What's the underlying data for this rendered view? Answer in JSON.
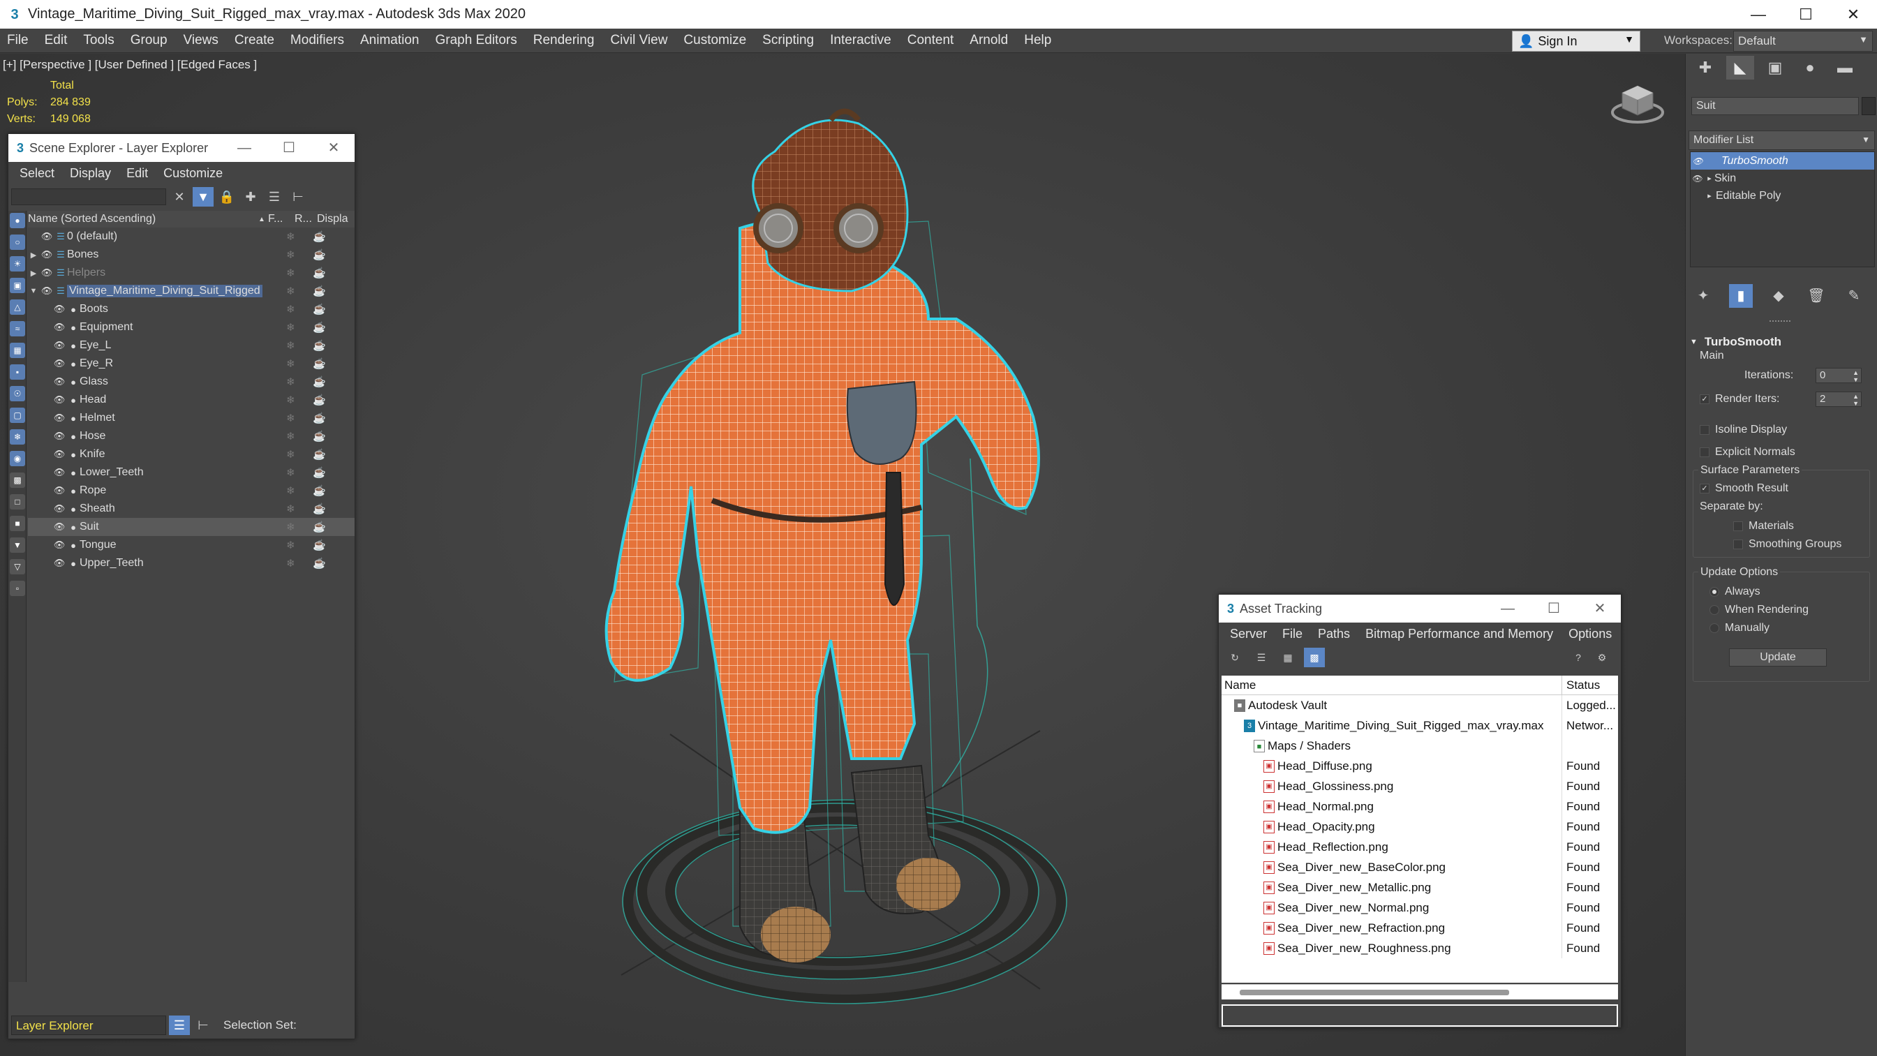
{
  "window": {
    "title": "Vintage_Maritime_Diving_Suit_Rigged_max_vray.max - Autodesk 3ds Max 2020",
    "minimize_icon": "minimize-icon",
    "maximize_icon": "maximize-icon",
    "close_icon": "close-icon"
  },
  "menubar": {
    "items": [
      "File",
      "Edit",
      "Tools",
      "Group",
      "Views",
      "Create",
      "Modifiers",
      "Animation",
      "Graph Editors",
      "Rendering",
      "Civil View",
      "Customize",
      "Scripting",
      "Interactive",
      "Content",
      "Arnold",
      "Help"
    ],
    "signin_label": "Sign In",
    "workspaces_label": "Workspaces:",
    "workspace_value": "Default"
  },
  "viewport": {
    "label": "[+] [Perspective ] [User Defined ] [Edged Faces ]",
    "stats": {
      "total_label": "Total",
      "polys_label": "Polys:",
      "polys_value": "284 839",
      "verts_label": "Verts:",
      "verts_value": "149 068"
    },
    "colors": {
      "suit": "#e8743a",
      "wire": "#ffffff",
      "selection": "#35d2e6",
      "bones": "#2fb6a8"
    }
  },
  "scene_explorer": {
    "title": "Scene Explorer - Layer Explorer",
    "menu": [
      "Select",
      "Display",
      "Edit",
      "Customize"
    ],
    "columns": {
      "name": "Name (Sorted Ascending)",
      "c1": "F...",
      "c2": "R...",
      "c3": "Displa"
    },
    "rows": [
      {
        "name": "0 (default)",
        "level": 0,
        "expand": "",
        "type": "layer"
      },
      {
        "name": "Bones",
        "level": 0,
        "expand": "▶",
        "type": "layer"
      },
      {
        "name": "Helpers",
        "level": 0,
        "expand": "▶",
        "type": "layer",
        "dim": true
      },
      {
        "name": "Vintage_Maritime_Diving_Suit_Rigged",
        "level": 0,
        "expand": "▼",
        "type": "layer",
        "highlight": true
      },
      {
        "name": "Boots",
        "level": 1,
        "type": "object"
      },
      {
        "name": "Equipment",
        "level": 1,
        "type": "object"
      },
      {
        "name": "Eye_L",
        "level": 1,
        "type": "object"
      },
      {
        "name": "Eye_R",
        "level": 1,
        "type": "object"
      },
      {
        "name": "Glass",
        "level": 1,
        "type": "object"
      },
      {
        "name": "Head",
        "level": 1,
        "type": "object"
      },
      {
        "name": "Helmet",
        "level": 1,
        "type": "object"
      },
      {
        "name": "Hose",
        "level": 1,
        "type": "object"
      },
      {
        "name": "Knife",
        "level": 1,
        "type": "object"
      },
      {
        "name": "Lower_Teeth",
        "level": 1,
        "type": "object"
      },
      {
        "name": "Rope",
        "level": 1,
        "type": "object"
      },
      {
        "name": "Sheath",
        "level": 1,
        "type": "object"
      },
      {
        "name": "Suit",
        "level": 1,
        "type": "object",
        "selected": true
      },
      {
        "name": "Tongue",
        "level": 1,
        "type": "object"
      },
      {
        "name": "Upper_Teeth",
        "level": 1,
        "type": "object"
      }
    ],
    "footer": {
      "explorer_name": "Layer Explorer",
      "selection_set_label": "Selection Set:"
    }
  },
  "asset_tracking": {
    "title": "Asset Tracking",
    "menu": [
      "Server",
      "File",
      "Paths",
      "Bitmap Performance and Memory",
      "Options"
    ],
    "columns": {
      "name": "Name",
      "status": "Status"
    },
    "rows": [
      {
        "name": "Autodesk Vault",
        "status": "Logged...",
        "level": 1,
        "icon": "vault"
      },
      {
        "name": "Vintage_Maritime_Diving_Suit_Rigged_max_vray.max",
        "status": "Networ...",
        "level": 2,
        "icon": "max"
      },
      {
        "name": "Maps / Shaders",
        "status": "",
        "level": 3,
        "icon": "folder"
      },
      {
        "name": "Head_Diffuse.png",
        "status": "Found",
        "level": 4,
        "icon": "file"
      },
      {
        "name": "Head_Glossiness.png",
        "status": "Found",
        "level": 4,
        "icon": "file"
      },
      {
        "name": "Head_Normal.png",
        "status": "Found",
        "level": 4,
        "icon": "file"
      },
      {
        "name": "Head_Opacity.png",
        "status": "Found",
        "level": 4,
        "icon": "file"
      },
      {
        "name": "Head_Reflection.png",
        "status": "Found",
        "level": 4,
        "icon": "file"
      },
      {
        "name": "Sea_Diver_new_BaseColor.png",
        "status": "Found",
        "level": 4,
        "icon": "file"
      },
      {
        "name": "Sea_Diver_new_Metallic.png",
        "status": "Found",
        "level": 4,
        "icon": "file"
      },
      {
        "name": "Sea_Diver_new_Normal.png",
        "status": "Found",
        "level": 4,
        "icon": "file"
      },
      {
        "name": "Sea_Diver_new_Refraction.png",
        "status": "Found",
        "level": 4,
        "icon": "file"
      },
      {
        "name": "Sea_Diver_new_Roughness.png",
        "status": "Found",
        "level": 4,
        "icon": "file"
      }
    ]
  },
  "command_panel": {
    "object_name": "Suit",
    "modifier_list_label": "Modifier List",
    "stack": [
      {
        "name": "TurboSmooth",
        "selected": true,
        "expand": ""
      },
      {
        "name": "Skin",
        "selected": false,
        "expand": "▸"
      },
      {
        "name": "Editable Poly",
        "selected": false,
        "expand": "▸"
      }
    ],
    "turbosmooth": {
      "title": "TurboSmooth",
      "main_label": "Main",
      "iterations_label": "Iterations:",
      "iterations_value": "0",
      "render_iters_label": "Render Iters:",
      "render_iters_value": "2",
      "render_iters_checked": true,
      "isoline_label": "Isoline Display",
      "explicit_normals_label": "Explicit Normals",
      "surface_params_label": "Surface Parameters",
      "smooth_result_label": "Smooth Result",
      "separate_by_label": "Separate by:",
      "materials_label": "Materials",
      "smoothing_groups_label": "Smoothing Groups",
      "update_options_label": "Update Options",
      "always_label": "Always",
      "when_rendering_label": "When Rendering",
      "manually_label": "Manually",
      "update_button": "Update"
    }
  }
}
